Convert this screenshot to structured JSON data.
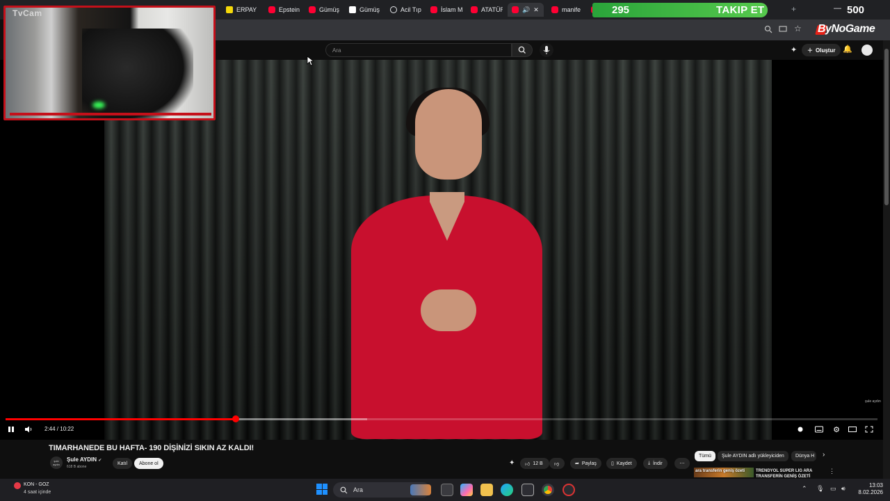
{
  "browser": {
    "tabs": [
      {
        "label": "ERPAY",
        "icon": "s-icon"
      },
      {
        "label": "Epstein",
        "icon": "youtube-icon"
      },
      {
        "label": "Gümüş",
        "icon": "youtube-icon"
      },
      {
        "label": "Gümüş",
        "icon": "b-icon"
      },
      {
        "label": "Acil Tıp",
        "icon": "globe-icon"
      },
      {
        "label": "İslam M",
        "icon": "youtube-icon"
      },
      {
        "label": "ATATÜR",
        "icon": "youtube-icon"
      },
      {
        "label": "",
        "icon": "youtube-icon",
        "active": true
      },
      {
        "label": "manife",
        "icon": "youtube-icon"
      },
      {
        "label": "",
        "icon": "youtube-icon"
      }
    ],
    "brand": "ByNoGame",
    "new_tab": "+",
    "minimize": "—"
  },
  "overlay": {
    "webcam_label": "TvCam",
    "follow_count": "295",
    "follow_label": "TAKIP ET",
    "follow_goal": "500"
  },
  "youtube": {
    "search_placeholder": "Ara",
    "create_label": "Oluştur",
    "video": {
      "current_time": "2:44",
      "duration": "10:22",
      "time_text": "2:44 / 10:22",
      "progress": 0.264,
      "buffered": 0.415,
      "watermark": "şule aydın"
    },
    "title": "TIMARHANEDE BU HAFTA- 190 DİŞİNİZİ SIKIN AZ KALDI!",
    "channel": {
      "name": "Şule AYDIN",
      "subscribers": "618 B abone",
      "avatar_text": "şule aydın",
      "join_label": "Katıl",
      "subscribe_label": "Abone ol"
    },
    "actions": {
      "likes": "12 B",
      "share": "Paylaş",
      "save": "Kaydet",
      "download": "İndir",
      "more": "⋯"
    },
    "chips": [
      "Tümü",
      "Şule AYDIN adlı yükleyiciden",
      "Dünya H"
    ],
    "recommendation": {
      "thumb_text": "ara transferin geniş özeti",
      "title": "TRENDYOL SÜPER LİG ARA TRANSFERİN GENİŞ ÖZETİ"
    }
  },
  "notification": {
    "title": "KON - GOZ",
    "subtitle": "4 saat içinde"
  },
  "taskbar": {
    "search_label": "Ara",
    "time": "13:03",
    "date": "8.02.2026"
  },
  "colors": {
    "accent_red": "#ff0000",
    "follow_green": "#3cb043",
    "dress_red": "#c8102e"
  }
}
